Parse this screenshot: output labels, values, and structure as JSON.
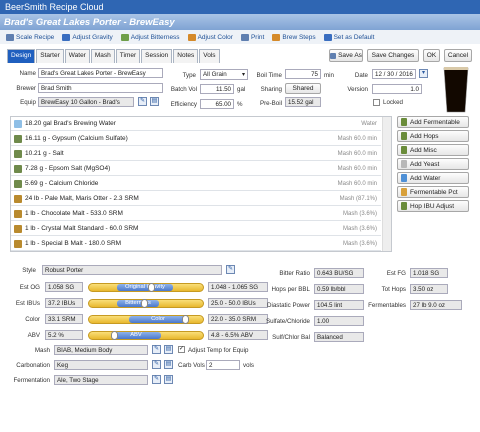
{
  "app": {
    "title": "BeerSmith Recipe Cloud"
  },
  "recipe": {
    "title": "Brad's Great Lakes Porter - BrewEasy"
  },
  "toolbar": [
    {
      "label": "Scale Recipe",
      "icon": "scale-icon"
    },
    {
      "label": "Adjust Gravity",
      "icon": "gravity-icon"
    },
    {
      "label": "Adjust Bitterness",
      "icon": "hops-icon"
    },
    {
      "label": "Adjust Color",
      "icon": "color-icon"
    },
    {
      "label": "Print",
      "icon": "printer-icon"
    },
    {
      "label": "Brew Steps",
      "icon": "steps-icon"
    },
    {
      "label": "Set as Default",
      "icon": "default-icon"
    }
  ],
  "tabs": [
    "Design",
    "Starter",
    "Water",
    "Mash",
    "Timer",
    "Session",
    "Notes",
    "Vols"
  ],
  "actions": {
    "save_as": "Save As",
    "save_changes": "Save Changes",
    "ok": "OK",
    "cancel": "Cancel"
  },
  "form": {
    "name_label": "Name",
    "name": "Brad's Great Lakes Porter - BrewEasy",
    "brewer_label": "Brewer",
    "brewer": "Brad Smith",
    "equip_label": "Equip",
    "equip": "BrewEasy 10 Gallon - Brad's",
    "type_label": "Type",
    "type": "All Grain",
    "batch_label": "Batch Vol",
    "batch": "11.50",
    "batch_unit": "gal",
    "eff_label": "Efficiency",
    "eff": "65.00",
    "eff_unit": "%",
    "boil_label": "Boil Time",
    "boil": "75",
    "boil_unit": "min",
    "sharing_label": "Sharing",
    "sharing": "Shared",
    "preboil_label": "Pre-Boil",
    "preboil": "15.52 gal",
    "date_label": "Date",
    "date": "12 / 30 / 2016",
    "version_label": "Version",
    "version": "1.0",
    "locked_label": "Locked"
  },
  "ingredients": [
    {
      "name": "18.20 gal Brad's Brewing Water",
      "type": "Water",
      "icon": "water"
    },
    {
      "name": "16.11 g - Gypsum (Calcium Sulfate)",
      "type": "Mash 60.0 min",
      "icon": "misc"
    },
    {
      "name": "10.21 g - Salt",
      "type": "Mash 60.0 min",
      "icon": "misc"
    },
    {
      "name": "7.28 g - Epsom Salt (MgSO4)",
      "type": "Mash 60.0 min",
      "icon": "misc"
    },
    {
      "name": "5.69 g - Calcium Chloride",
      "type": "Mash 60.0 min",
      "icon": "misc"
    },
    {
      "name": "24 lb - Pale Malt, Maris Otter - 2.3 SRM",
      "type": "Mash (87.1%)",
      "icon": "grain"
    },
    {
      "name": "1 lb - Chocolate Malt - 533.0 SRM",
      "type": "Mash (3.6%)",
      "icon": "grain"
    },
    {
      "name": "1 lb - Crystal Malt Standard - 60.0 SRM",
      "type": "Mash (3.6%)",
      "icon": "grain"
    },
    {
      "name": "1 lb - Special B Malt - 180.0 SRM",
      "type": "Mash (3.6%)",
      "icon": "grain"
    }
  ],
  "add_buttons": [
    "Add Fermentable",
    "Add Hops",
    "Add Misc",
    "Add Yeast",
    "Add Water",
    "Fermentable Pct",
    "Hop IBU Adjust"
  ],
  "style": {
    "label": "Style",
    "value": "Robust Porter"
  },
  "stats": [
    {
      "label": "Est OG",
      "value": "1.058 SG",
      "gauge": "Original Gravity",
      "range": "1.048 - 1.065 SG",
      "pos": 0.55
    },
    {
      "label": "Est IBUs",
      "value": "37.2 IBUs",
      "gauge": "Bitterness",
      "range": "25.0 - 50.0 IBUs",
      "pos": 0.49
    },
    {
      "label": "Color",
      "value": "33.1 SRM",
      "gauge": "Color",
      "range": "22.0 - 35.0 SRM",
      "pos": 0.85
    },
    {
      "label": "ABV",
      "value": "5.2 %",
      "gauge": "ABV",
      "range": "4.8 - 6.5% ABV",
      "pos": 0.23
    }
  ],
  "right_stats": [
    {
      "label": "Bitter Ratio",
      "value": "0.643 BU/SG"
    },
    {
      "label": "Hops per BBL",
      "value": "0.59 lb/bbl"
    },
    {
      "label": "Diastatic Power",
      "value": "104.5 lint"
    },
    {
      "label": "Sulfate/Chloride",
      "value": "1.00"
    },
    {
      "label": "Sulf/Chlor Bal",
      "value": "Balanced"
    }
  ],
  "far_stats": [
    {
      "label": "Est FG",
      "value": "1.018 SG"
    },
    {
      "label": "Tot Hops",
      "value": "3.50 oz"
    },
    {
      "label": "Fermentables",
      "value": "27 lb 9.0 oz"
    }
  ],
  "profiles": {
    "mash_label": "Mash",
    "mash": "BIAB, Medium Body",
    "adjust_label": "Adjust Temp for Equip",
    "carb_label": "Carbonation",
    "carb": "Keg",
    "carbvols_label": "Carb Vols",
    "carbvols": "2",
    "carbvols_unit": "vols",
    "ferm_label": "Fermentation",
    "ferm": "Ale, Two Stage"
  },
  "colors": {
    "beer": "#120800",
    "accent": "#1f5fbf",
    "gauge": "#e8b82e"
  }
}
